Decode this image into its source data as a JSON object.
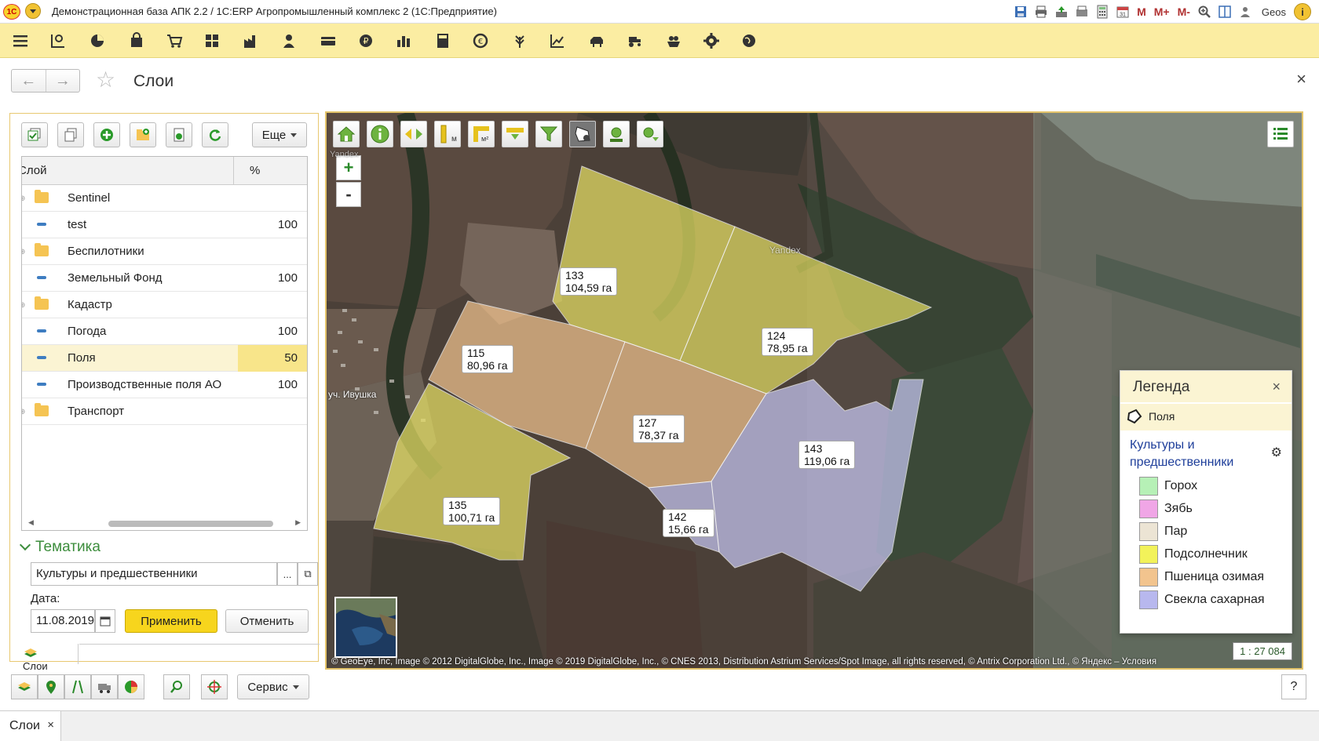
{
  "window": {
    "title": "Демонстрационная база АПК 2.2 / 1С:ERP Агропромышленный комплекс 2  (1С:Предприятие)",
    "logo": "1С",
    "user": "Geos",
    "memory_buttons": [
      "M",
      "M+",
      "M-"
    ],
    "calendar_day": "31"
  },
  "nav": {
    "page_title": "Слои",
    "close": "×"
  },
  "layers_panel": {
    "more_label": "Еще",
    "columns": {
      "layer": "Слой",
      "percent": "%"
    },
    "rows": [
      {
        "name": "Sentinel",
        "type": "folder",
        "percent": ""
      },
      {
        "name": "test",
        "type": "layer",
        "percent": "100"
      },
      {
        "name": "Беспилотники",
        "type": "folder",
        "percent": ""
      },
      {
        "name": "Земельный Фонд",
        "type": "layer",
        "percent": "100"
      },
      {
        "name": "Кадастр",
        "type": "folder",
        "percent": ""
      },
      {
        "name": "Погода",
        "type": "layer",
        "percent": "100"
      },
      {
        "name": "Поля",
        "type": "layer",
        "percent": "50",
        "selected": true
      },
      {
        "name": "Производственные поля АО",
        "type": "layer",
        "percent": "100"
      },
      {
        "name": "Транспорт",
        "type": "folder",
        "percent": ""
      }
    ],
    "thematic_title": "Тематика",
    "thematic_value": "Культуры и предшественники",
    "date_label": "Дата:",
    "date_value": "11.08.2019",
    "apply_label": "Применить",
    "cancel_label": "Отменить",
    "mini_tab_label": "Слои"
  },
  "map": {
    "place_label": "уч. Ивушка",
    "yandex_watermark": "Yandex",
    "yandex_watermark_left": "Yandex",
    "zoom_in": "+",
    "zoom_out": "-",
    "copyright": "© GeoEye, Inc, Image © 2012 DigitalGlobe, Inc., Image © 2019 DigitalGlobe, Inc., © CNES 2013, Distribution Astrium Services/Spot Image, all rights reserved, © Antrix Corporation Ltd., © Яндекс – Условия",
    "scale": "1 : 27 084",
    "fields": [
      {
        "id": "133",
        "area": "104,59 га",
        "crop": "Подсолнечник"
      },
      {
        "id": "124",
        "area": "78,95 га",
        "crop": "Подсолнечник"
      },
      {
        "id": "115",
        "area": "80,96 га",
        "crop": "Пшеница озимая"
      },
      {
        "id": "127",
        "area": "78,37 га",
        "crop": "Пшеница озимая"
      },
      {
        "id": "143",
        "area": "119,06 га",
        "crop": "Свекла сахарная"
      },
      {
        "id": "142",
        "area": "15,66 га",
        "crop": "Свекла сахарная"
      },
      {
        "id": "135",
        "area": "100,71 га",
        "crop": "Подсолнечник"
      }
    ]
  },
  "legend": {
    "title": "Легенда",
    "close": "×",
    "layer_name": "Поля",
    "theme": "Культуры и предшественники",
    "items": [
      {
        "label": "Горох",
        "color": "#b6f0b6"
      },
      {
        "label": "Зябь",
        "color": "#f0a6e6"
      },
      {
        "label": "Пар",
        "color": "#ece4d4"
      },
      {
        "label": "Подсолнечник",
        "color": "#f2f25a"
      },
      {
        "label": "Пшеница озимая",
        "color": "#f2c48e"
      },
      {
        "label": "Свекла сахарная",
        "color": "#b8b8ee"
      }
    ]
  },
  "bottom": {
    "service_label": "Сервис",
    "help": "?",
    "window_tab": "Слои",
    "window_tab_close": "×"
  },
  "colors": {
    "accent_yellow": "#f7d51d",
    "section_bar": "#fbeda2",
    "thematic_green": "#3c8d3c",
    "legend_link": "#1e3e9a"
  }
}
